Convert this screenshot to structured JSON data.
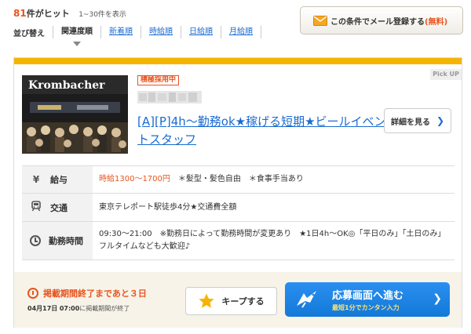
{
  "results": {
    "count": "81",
    "unit": "件がヒット",
    "range": "1~30件を表示"
  },
  "sort": {
    "label": "並び替え",
    "options": [
      "関連度順",
      "新着順",
      "時給順",
      "日給順",
      "月給順"
    ],
    "active": "関連度順"
  },
  "mail_button": {
    "label": "この条件でメール登録する",
    "free": "(無料)"
  },
  "card": {
    "pickup": "Pick UP",
    "photo_sign": "Krombacher",
    "badge": "積極採用中",
    "title": "[A][P]4h～勤務ok★稼げる短期★ビールイベントスタッフ",
    "detail_button": "詳細を見る",
    "info": [
      {
        "icon": "yen-icon",
        "label": "給与",
        "highlight": "時給1300～1700円",
        "text": "＊髪型・髪色自由　＊食事手当あり"
      },
      {
        "icon": "train-icon",
        "label": "交通",
        "text": "東京テレポート駅徒歩4分★交通費全額"
      },
      {
        "icon": "clock-icon",
        "label": "勤務時間",
        "text": "09:30～21:00　※勤務日によって勤務時間が変更あり　★1日4h～OK◎「平日のみ」「土日のみ」　フルタイムなども大歓迎♪"
      }
    ],
    "deadline": "掲載期間終了まであと３日",
    "deadline_date": "04月17日",
    "deadline_time": "07:00",
    "deadline_suffix": "に掲載期間が終了",
    "keep_button": "キープする",
    "apply_button": {
      "main": "応募画面へ進む",
      "sub": "最短1分でカンタン入力"
    }
  },
  "colors": {
    "accent": "#e8541e",
    "link": "#1a6bd1",
    "card_top": "#f5b400",
    "apply": "#1f86e6"
  }
}
